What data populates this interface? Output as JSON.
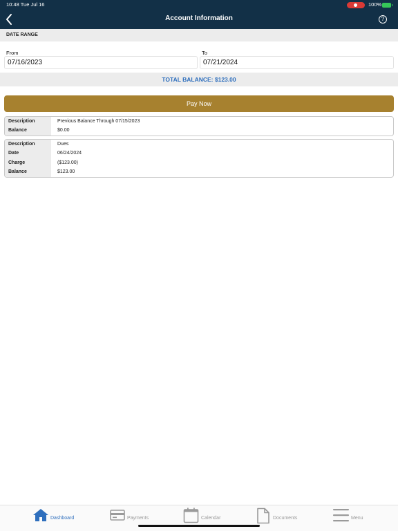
{
  "status": {
    "time": "10:48  Tue Jul 16",
    "battery": "100%"
  },
  "header": {
    "title": "Account Information",
    "help_symbol": "?"
  },
  "date_range": {
    "heading": "DATE RANGE",
    "from_label": "From",
    "from_value": "07/16/2023",
    "to_label": "To",
    "to_value": "07/21/2024"
  },
  "total_balance": "TOTAL BALANCE: $123.00",
  "pay_button": "Pay Now",
  "entries": [
    {
      "rows": [
        {
          "key": "Description",
          "value": "Previous Balance Through 07/15/2023"
        },
        {
          "key": "Balance",
          "value": "$0.00"
        }
      ]
    },
    {
      "rows": [
        {
          "key": "Description",
          "value": "Dues"
        },
        {
          "key": "Date",
          "value": "06/24/2024"
        },
        {
          "key": "Charge",
          "value": "($123.00)"
        },
        {
          "key": "Balance",
          "value": "$123.00"
        }
      ]
    }
  ],
  "tabs": [
    {
      "label": "Dashboard",
      "icon": "home-icon",
      "active": true
    },
    {
      "label": "Payments",
      "icon": "credit-card-icon",
      "active": false
    },
    {
      "label": "Calendar",
      "icon": "calendar-icon",
      "active": false
    },
    {
      "label": "Documents",
      "icon": "document-icon",
      "active": false
    },
    {
      "label": "Menu",
      "icon": "menu-icon",
      "active": false
    }
  ],
  "colors": {
    "header_bg": "#123047",
    "accent_blue": "#2f6fbd",
    "pay_gold": "#a7812f",
    "inactive_tab": "#9a9a9a"
  }
}
